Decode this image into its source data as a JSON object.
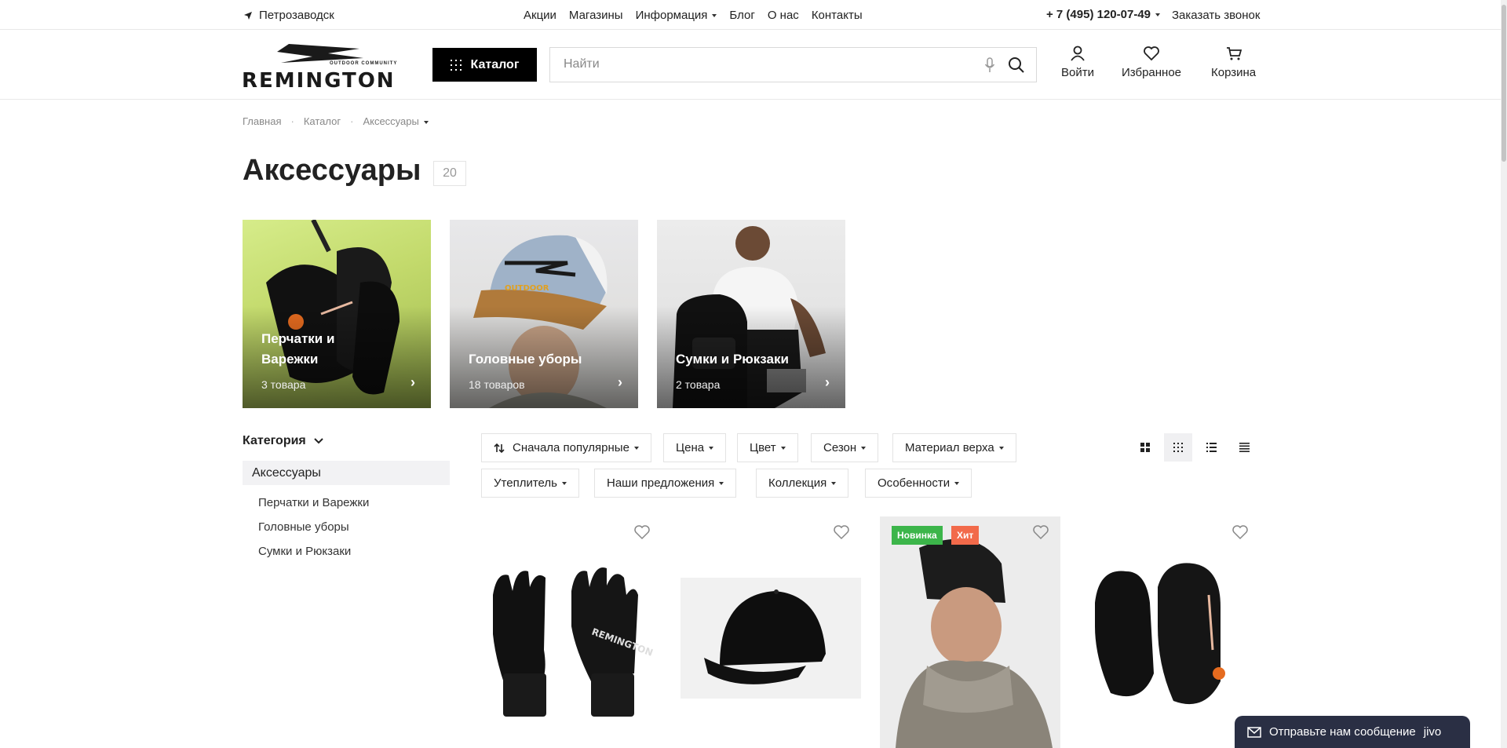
{
  "topbar": {
    "city": "Петрозаводск",
    "nav": [
      "Акции",
      "Магазины",
      "Информация",
      "Блог",
      "О нас",
      "Контакты"
    ],
    "phone": "+ 7 (495) 120-07-49",
    "callback": "Заказать звонок"
  },
  "header": {
    "logo_text": "REMINGTON",
    "logo_sub": "OUTDOOR COMMUNITY",
    "catalog_label": "Каталог",
    "search_placeholder": "Найти",
    "actions": {
      "login": "Войти",
      "favorites": "Избранное",
      "cart": "Корзина"
    }
  },
  "breadcrumbs": [
    "Главная",
    "Каталог",
    "Аксессуары"
  ],
  "page": {
    "title": "Аксессуары",
    "count": "20"
  },
  "categories": [
    {
      "name": "Перчатки и Варежки",
      "qty": "3 товара"
    },
    {
      "name": "Головные уборы",
      "qty": "18 товаров"
    },
    {
      "name": "Сумки и Рюкзаки",
      "qty": "2 товара"
    }
  ],
  "sidebar": {
    "heading": "Категория",
    "active": "Аксессуары",
    "items": [
      "Перчатки и Варежки",
      "Головные уборы",
      "Сумки и Рюкзаки"
    ]
  },
  "filters": {
    "sort": "Сначала популярные",
    "row1": [
      "Цена",
      "Цвет",
      "Сезон",
      "Материал верха"
    ],
    "row2": [
      "Утеплитель",
      "Наши предложения",
      "Коллекция",
      "Особенности"
    ]
  },
  "badges": {
    "new": "Новинка",
    "hit": "Хит"
  },
  "chat": {
    "label": "Отправьте нам сообщение",
    "brand": "jivo"
  },
  "colors": {
    "accent": "#000000",
    "badge_new": "#3cb54a",
    "badge_hit": "#f26a4a",
    "chat_bg": "#2a2f44"
  }
}
